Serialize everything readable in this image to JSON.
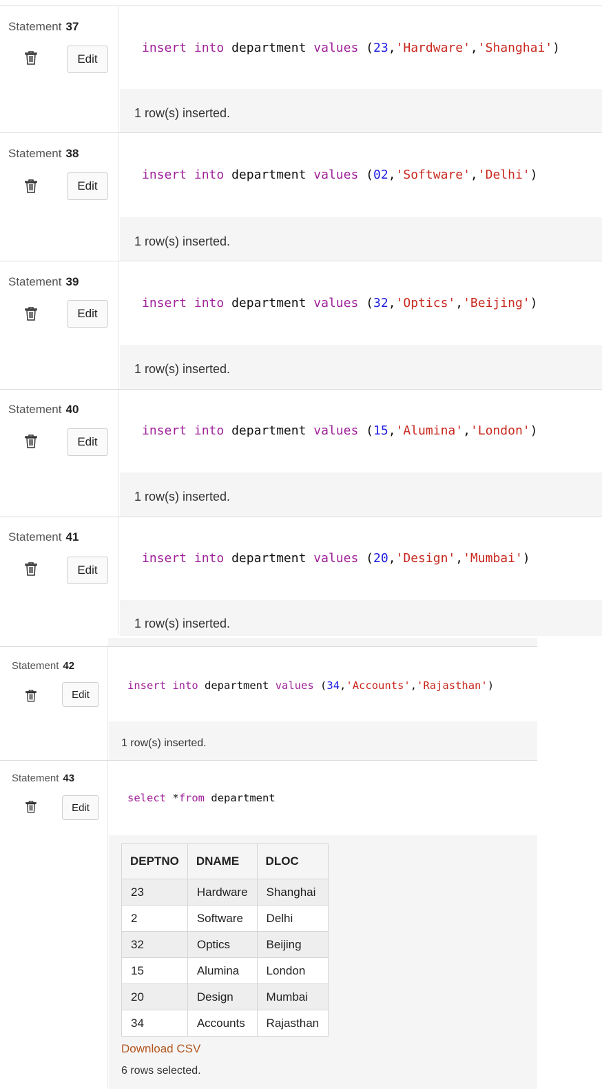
{
  "keywords": {
    "insert": "insert",
    "into": "into",
    "values": "values",
    "select": "select",
    "from": "from"
  },
  "table_name": "department",
  "statement_label": "Statement",
  "edit_label": "Edit",
  "insert_result": "1 row(s) inserted.",
  "statements": [
    {
      "number": "37",
      "values": [
        "23",
        "'Hardware'",
        "'Shanghai'"
      ]
    },
    {
      "number": "38",
      "values": [
        "02",
        "'Software'",
        "'Delhi'"
      ]
    },
    {
      "number": "39",
      "values": [
        "32",
        "'Optics'",
        "'Beijing'"
      ]
    },
    {
      "number": "40",
      "values": [
        "15",
        "'Alumina'",
        "'London'"
      ]
    },
    {
      "number": "41",
      "values": [
        "20",
        "'Design'",
        "'Mumbai'"
      ]
    },
    {
      "number": "42",
      "values": [
        "34",
        "'Accounts'",
        "'Rajasthan'"
      ]
    }
  ],
  "select_statement": {
    "number": "43",
    "star": "*"
  },
  "result_table": {
    "columns": [
      "DEPTNO",
      "DNAME",
      "DLOC"
    ],
    "rows": [
      [
        "23",
        "Hardware",
        "Shanghai"
      ],
      [
        "2",
        "Software",
        "Delhi"
      ],
      [
        "32",
        "Optics",
        "Beijing"
      ],
      [
        "15",
        "Alumina",
        "London"
      ],
      [
        "20",
        "Design",
        "Mumbai"
      ],
      [
        "34",
        "Accounts",
        "Rajasthan"
      ]
    ]
  },
  "download_label": "Download CSV",
  "rows_selected": "6 rows selected."
}
